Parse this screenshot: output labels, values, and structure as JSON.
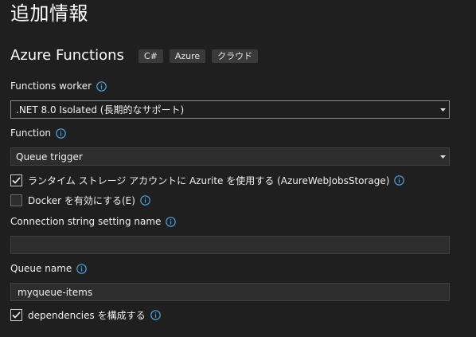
{
  "page": {
    "title": "追加情報"
  },
  "template": {
    "name": "Azure Functions",
    "tags": [
      "C#",
      "Azure",
      "クラウド"
    ]
  },
  "functions_worker": {
    "label": "Functions worker",
    "value": ".NET 8.0 Isolated (長期的なサポート)"
  },
  "function": {
    "label": "Function",
    "value": "Queue trigger"
  },
  "azurite": {
    "label": "ランタイム ストレージ アカウントに Azurite を使用する (AzureWebJobsStorage)",
    "checked": true
  },
  "docker": {
    "label": "Docker を有効にする(E)",
    "checked": false
  },
  "connection_string": {
    "label": "Connection string setting name",
    "value": ""
  },
  "queue_name": {
    "label": "Queue name",
    "value": "myqueue-items"
  },
  "dependencies": {
    "label": "dependencies を構成する",
    "checked": true
  },
  "colors": {
    "background": "#1f1f1f",
    "info_icon": "#4aa3df",
    "field_background": "#2d2d2d"
  }
}
